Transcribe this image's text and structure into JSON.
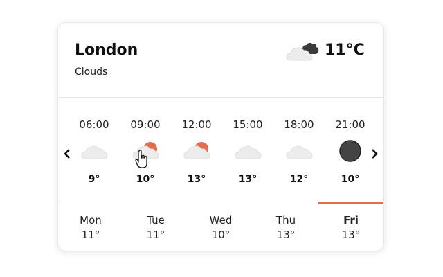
{
  "current": {
    "city": "London",
    "condition": "Clouds",
    "temperature": "11°C",
    "icon": "cloudy-icon"
  },
  "hourly": [
    {
      "time": "06:00",
      "temp": "9°",
      "icon": "cloud-icon"
    },
    {
      "time": "09:00",
      "temp": "10°",
      "icon": "partly-cloudy-icon"
    },
    {
      "time": "12:00",
      "temp": "13°",
      "icon": "partly-cloudy-icon"
    },
    {
      "time": "15:00",
      "temp": "13°",
      "icon": "cloud-icon"
    },
    {
      "time": "18:00",
      "temp": "12°",
      "icon": "cloud-icon"
    },
    {
      "time": "21:00",
      "temp": "10°",
      "icon": "moon-icon"
    }
  ],
  "daily": [
    {
      "day": "Mon",
      "temp": "11°"
    },
    {
      "day": "Tue",
      "temp": "11°"
    },
    {
      "day": "Wed",
      "temp": "10°"
    },
    {
      "day": "Thu",
      "temp": "13°"
    },
    {
      "day": "Fri",
      "temp": "13°",
      "active": true
    }
  ],
  "colors": {
    "accent": "#e86a4a",
    "cloud": "#e8e8e8",
    "moon": "#444444"
  }
}
